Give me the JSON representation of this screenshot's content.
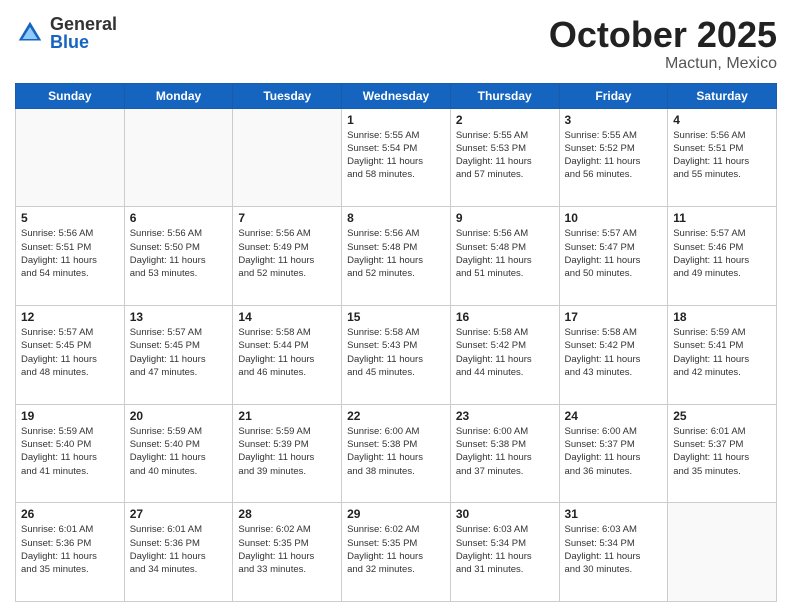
{
  "header": {
    "logo_general": "General",
    "logo_blue": "Blue",
    "month": "October 2025",
    "location": "Mactun, Mexico"
  },
  "weekdays": [
    "Sunday",
    "Monday",
    "Tuesday",
    "Wednesday",
    "Thursday",
    "Friday",
    "Saturday"
  ],
  "weeks": [
    [
      {
        "day": "",
        "info": ""
      },
      {
        "day": "",
        "info": ""
      },
      {
        "day": "",
        "info": ""
      },
      {
        "day": "1",
        "info": "Sunrise: 5:55 AM\nSunset: 5:54 PM\nDaylight: 11 hours\nand 58 minutes."
      },
      {
        "day": "2",
        "info": "Sunrise: 5:55 AM\nSunset: 5:53 PM\nDaylight: 11 hours\nand 57 minutes."
      },
      {
        "day": "3",
        "info": "Sunrise: 5:55 AM\nSunset: 5:52 PM\nDaylight: 11 hours\nand 56 minutes."
      },
      {
        "day": "4",
        "info": "Sunrise: 5:56 AM\nSunset: 5:51 PM\nDaylight: 11 hours\nand 55 minutes."
      }
    ],
    [
      {
        "day": "5",
        "info": "Sunrise: 5:56 AM\nSunset: 5:51 PM\nDaylight: 11 hours\nand 54 minutes."
      },
      {
        "day": "6",
        "info": "Sunrise: 5:56 AM\nSunset: 5:50 PM\nDaylight: 11 hours\nand 53 minutes."
      },
      {
        "day": "7",
        "info": "Sunrise: 5:56 AM\nSunset: 5:49 PM\nDaylight: 11 hours\nand 52 minutes."
      },
      {
        "day": "8",
        "info": "Sunrise: 5:56 AM\nSunset: 5:48 PM\nDaylight: 11 hours\nand 52 minutes."
      },
      {
        "day": "9",
        "info": "Sunrise: 5:56 AM\nSunset: 5:48 PM\nDaylight: 11 hours\nand 51 minutes."
      },
      {
        "day": "10",
        "info": "Sunrise: 5:57 AM\nSunset: 5:47 PM\nDaylight: 11 hours\nand 50 minutes."
      },
      {
        "day": "11",
        "info": "Sunrise: 5:57 AM\nSunset: 5:46 PM\nDaylight: 11 hours\nand 49 minutes."
      }
    ],
    [
      {
        "day": "12",
        "info": "Sunrise: 5:57 AM\nSunset: 5:45 PM\nDaylight: 11 hours\nand 48 minutes."
      },
      {
        "day": "13",
        "info": "Sunrise: 5:57 AM\nSunset: 5:45 PM\nDaylight: 11 hours\nand 47 minutes."
      },
      {
        "day": "14",
        "info": "Sunrise: 5:58 AM\nSunset: 5:44 PM\nDaylight: 11 hours\nand 46 minutes."
      },
      {
        "day": "15",
        "info": "Sunrise: 5:58 AM\nSunset: 5:43 PM\nDaylight: 11 hours\nand 45 minutes."
      },
      {
        "day": "16",
        "info": "Sunrise: 5:58 AM\nSunset: 5:42 PM\nDaylight: 11 hours\nand 44 minutes."
      },
      {
        "day": "17",
        "info": "Sunrise: 5:58 AM\nSunset: 5:42 PM\nDaylight: 11 hours\nand 43 minutes."
      },
      {
        "day": "18",
        "info": "Sunrise: 5:59 AM\nSunset: 5:41 PM\nDaylight: 11 hours\nand 42 minutes."
      }
    ],
    [
      {
        "day": "19",
        "info": "Sunrise: 5:59 AM\nSunset: 5:40 PM\nDaylight: 11 hours\nand 41 minutes."
      },
      {
        "day": "20",
        "info": "Sunrise: 5:59 AM\nSunset: 5:40 PM\nDaylight: 11 hours\nand 40 minutes."
      },
      {
        "day": "21",
        "info": "Sunrise: 5:59 AM\nSunset: 5:39 PM\nDaylight: 11 hours\nand 39 minutes."
      },
      {
        "day": "22",
        "info": "Sunrise: 6:00 AM\nSunset: 5:38 PM\nDaylight: 11 hours\nand 38 minutes."
      },
      {
        "day": "23",
        "info": "Sunrise: 6:00 AM\nSunset: 5:38 PM\nDaylight: 11 hours\nand 37 minutes."
      },
      {
        "day": "24",
        "info": "Sunrise: 6:00 AM\nSunset: 5:37 PM\nDaylight: 11 hours\nand 36 minutes."
      },
      {
        "day": "25",
        "info": "Sunrise: 6:01 AM\nSunset: 5:37 PM\nDaylight: 11 hours\nand 35 minutes."
      }
    ],
    [
      {
        "day": "26",
        "info": "Sunrise: 6:01 AM\nSunset: 5:36 PM\nDaylight: 11 hours\nand 35 minutes."
      },
      {
        "day": "27",
        "info": "Sunrise: 6:01 AM\nSunset: 5:36 PM\nDaylight: 11 hours\nand 34 minutes."
      },
      {
        "day": "28",
        "info": "Sunrise: 6:02 AM\nSunset: 5:35 PM\nDaylight: 11 hours\nand 33 minutes."
      },
      {
        "day": "29",
        "info": "Sunrise: 6:02 AM\nSunset: 5:35 PM\nDaylight: 11 hours\nand 32 minutes."
      },
      {
        "day": "30",
        "info": "Sunrise: 6:03 AM\nSunset: 5:34 PM\nDaylight: 11 hours\nand 31 minutes."
      },
      {
        "day": "31",
        "info": "Sunrise: 6:03 AM\nSunset: 5:34 PM\nDaylight: 11 hours\nand 30 minutes."
      },
      {
        "day": "",
        "info": ""
      }
    ]
  ]
}
